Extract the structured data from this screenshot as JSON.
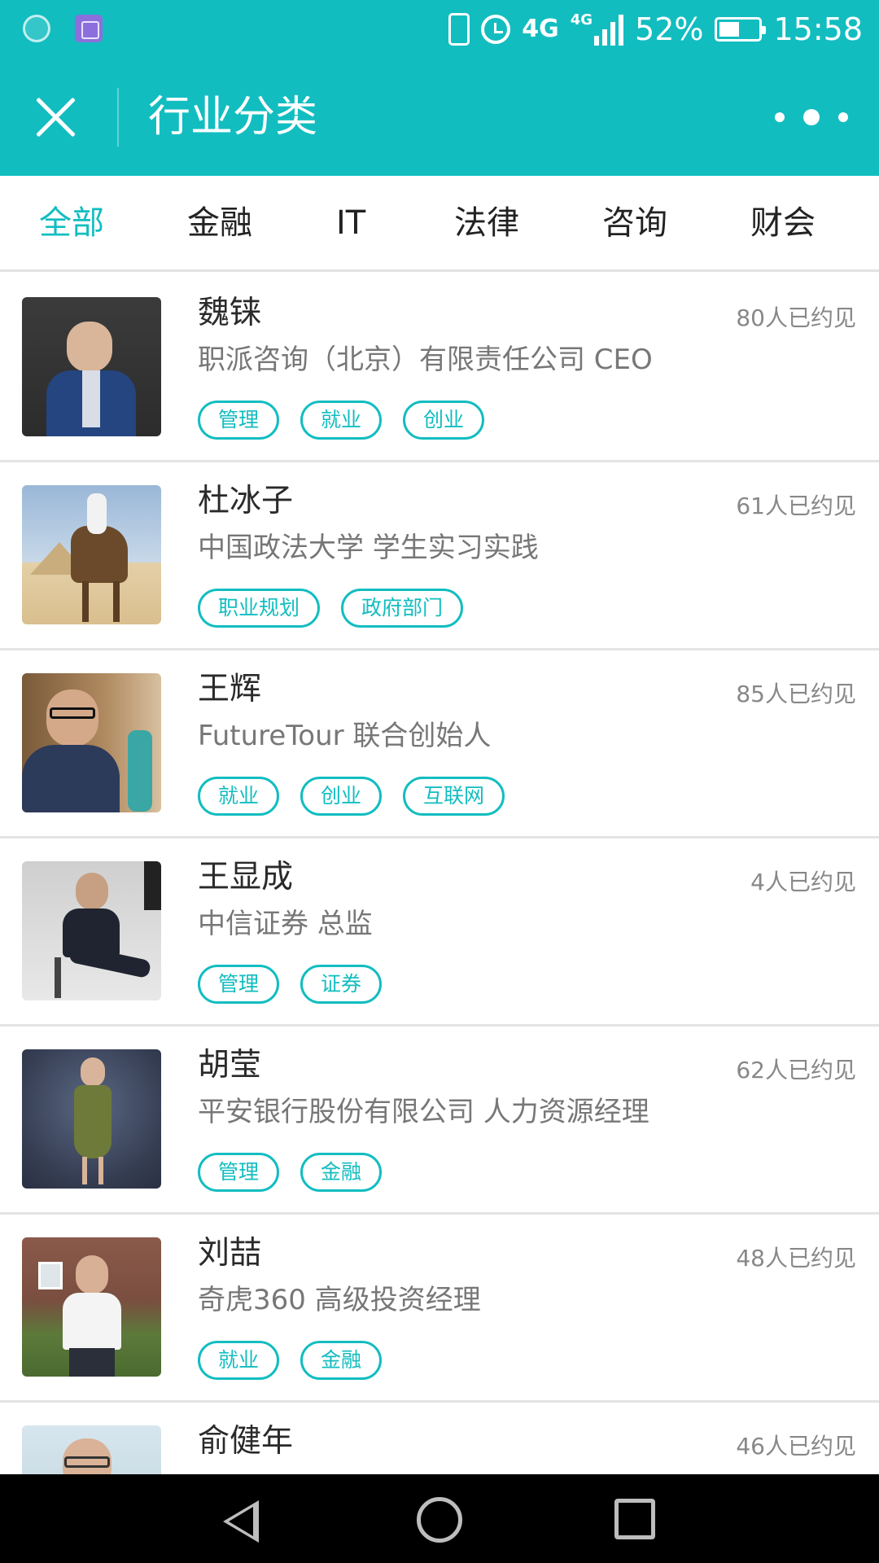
{
  "status_bar": {
    "network": "4G",
    "network_small": "4G",
    "battery": "52%",
    "battery_level": 0.52,
    "time": "15:58"
  },
  "header": {
    "title": "行业分类"
  },
  "tabs": [
    {
      "label": "全部",
      "active": true
    },
    {
      "label": "金融",
      "active": false
    },
    {
      "label": "IT",
      "active": false
    },
    {
      "label": "法律",
      "active": false
    },
    {
      "label": "咨询",
      "active": false
    },
    {
      "label": "财会",
      "active": false
    }
  ],
  "people": [
    {
      "name": "魏铼",
      "org": "职派咨询（北京）有限责任公司   CEO",
      "count": "80人已约见",
      "tags": [
        "管理",
        "就业",
        "创业"
      ]
    },
    {
      "name": "杜冰子",
      "org": "中国政法大学   学生实习实践",
      "count": "61人已约见",
      "tags": [
        "职业规划",
        "政府部门"
      ]
    },
    {
      "name": "王辉",
      "org": "FutureTour    联合创始人",
      "count": "85人已约见",
      "tags": [
        "就业",
        "创业",
        "互联网"
      ]
    },
    {
      "name": "王显成",
      "org": "中信证券   总监",
      "count": "4人已约见",
      "tags": [
        "管理",
        "证券"
      ]
    },
    {
      "name": "胡莹",
      "org": "平安银行股份有限公司   人力资源经理",
      "count": "62人已约见",
      "tags": [
        "管理",
        "金融"
      ]
    },
    {
      "name": "刘喆",
      "org": "奇虎360   高级投资经理",
      "count": "48人已约见",
      "tags": [
        "就业",
        "金融"
      ]
    },
    {
      "name": "俞健年",
      "org": "",
      "count": "46人已约见",
      "tags": []
    }
  ],
  "colors": {
    "accent": "#12bdc0",
    "text_secondary": "#777777"
  }
}
